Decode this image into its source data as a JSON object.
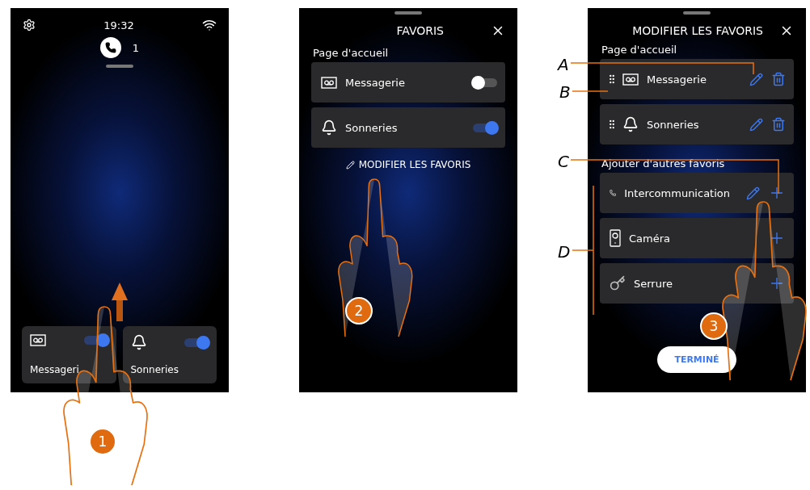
{
  "screens": [
    {
      "kind": "home",
      "step": "1",
      "time": "19:32",
      "missed_calls": "1",
      "tiles": [
        {
          "kind": "voicemail",
          "label": "Messageri",
          "on": true
        },
        {
          "kind": "bell",
          "label": "Sonneries",
          "on": true
        }
      ]
    },
    {
      "kind": "favorites",
      "step": "2",
      "title": "FAVORIS",
      "section": "Page d'accueil",
      "rows": [
        {
          "kind": "voicemail",
          "label": "Messagerie",
          "on": false
        },
        {
          "kind": "bell",
          "label": "Sonneries",
          "on": true
        }
      ],
      "link": "MODIFIER LES FAVORIS"
    },
    {
      "kind": "edit",
      "step": "3",
      "title": "MODIFIER LES FAVORIS",
      "sections": [
        {
          "heading": "Page d'accueil",
          "rows": [
            {
              "kind": "voicemail",
              "label": "Messagerie",
              "draggable": true,
              "editable": true,
              "removable": true,
              "addable": false
            },
            {
              "kind": "bell",
              "label": "Sonneries",
              "draggable": true,
              "editable": true,
              "removable": true,
              "addable": false
            }
          ]
        },
        {
          "heading": "Ajouter d'autres favoris",
          "rows": [
            {
              "kind": "phone",
              "label": "Intercommunication",
              "draggable": false,
              "editable": true,
              "removable": false,
              "addable": true
            },
            {
              "kind": "camera",
              "label": "Caméra",
              "draggable": false,
              "editable": false,
              "removable": false,
              "addable": true
            },
            {
              "kind": "key",
              "label": "Serrure",
              "draggable": false,
              "editable": false,
              "removable": false,
              "addable": true
            }
          ]
        }
      ],
      "button": "TERMINÉ"
    }
  ],
  "callouts": [
    "A",
    "B",
    "C",
    "D"
  ]
}
